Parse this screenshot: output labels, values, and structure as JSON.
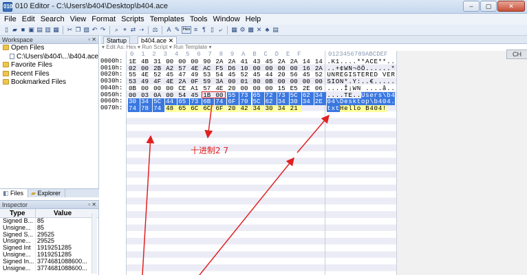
{
  "window": {
    "title": "010 Editor - C:\\Users\\b404\\Desktop\\b404.ace",
    "app_icon": "010",
    "buttons": [
      "–",
      "▢",
      "✕"
    ]
  },
  "menu": [
    "File",
    "Edit",
    "Search",
    "View",
    "Format",
    "Scripts",
    "Templates",
    "Tools",
    "Window",
    "Help"
  ],
  "workspace": {
    "title": "Workspace",
    "items": [
      {
        "label": "Open Files",
        "icon": "folder-icon",
        "indent": 0
      },
      {
        "label": "C:\\Users\\b404\\...\\b404.ace",
        "icon": "file-icon",
        "indent": 1
      },
      {
        "label": "Favorite Files",
        "icon": "folder-icon",
        "indent": 0
      },
      {
        "label": "Recent Files",
        "icon": "folder-icon",
        "indent": 0
      },
      {
        "label": "Bookmarked Files",
        "icon": "folder-icon",
        "indent": 0
      }
    ],
    "tabs": [
      "Files",
      "Explorer"
    ]
  },
  "inspector": {
    "title": "Inspector",
    "col_type": "Type",
    "col_value": "Value",
    "rows": [
      {
        "type": "Signed B...",
        "value": "85"
      },
      {
        "type": "Unsigne...",
        "value": "85"
      },
      {
        "type": "Signed S...",
        "value": "29525"
      },
      {
        "type": "Unsigne...",
        "value": "29525"
      },
      {
        "type": "Signed Int",
        "value": "1919251285"
      },
      {
        "type": "Unsigne...",
        "value": "1919251285"
      },
      {
        "type": "Signed In...",
        "value": "3774681088600..."
      },
      {
        "type": "Unsigne...",
        "value": "3774681088600..."
      }
    ]
  },
  "editor": {
    "tabs": [
      "Startup",
      "b404.ace"
    ],
    "toolbar_text": "▾ Edit As: Hex ▾  Run Script ▾  Run Template ▾",
    "hex_col_header": "0  1  2  3  4  5  6  7  8  9  A  B  C  D  E  F",
    "ascii_col_header": "0123456789ABCDEF",
    "rows": [
      {
        "addr": "0000h:",
        "hex": [
          "1E",
          "4B",
          "31",
          "00",
          "00",
          "00",
          "90",
          "2A",
          "2A",
          "41",
          "43",
          "45",
          "2A",
          "2A",
          "14",
          "14"
        ],
        "ascii": ".K1....**ACE**.."
      },
      {
        "addr": "0010h:",
        "hex": [
          "02",
          "00",
          "2B",
          "A2",
          "57",
          "4E",
          "AC",
          "F5",
          "D6",
          "10",
          "00",
          "00",
          "00",
          "00",
          "16",
          "2A"
        ],
        "ascii": "..+¢WN¬õÖ......*"
      },
      {
        "addr": "0020h:",
        "hex": [
          "55",
          "4E",
          "52",
          "45",
          "47",
          "49",
          "53",
          "54",
          "45",
          "52",
          "45",
          "44",
          "20",
          "56",
          "45",
          "52"
        ],
        "ascii": "UNREGISTERED VER"
      },
      {
        "addr": "0030h:",
        "hex": [
          "53",
          "49",
          "4F",
          "4E",
          "2A",
          "0F",
          "59",
          "3A",
          "00",
          "01",
          "80",
          "0B",
          "00",
          "00",
          "00",
          "00"
        ],
        "ascii": "SION*.Y:..€....."
      },
      {
        "addr": "0040h:",
        "hex": [
          "0B",
          "00",
          "00",
          "00",
          "CE",
          "A1",
          "57",
          "4E",
          "20",
          "00",
          "00",
          "00",
          "15",
          "E5",
          "2E",
          "06"
        ],
        "ascii": "....Î¡WN ....å.."
      },
      {
        "addr": "0050h:",
        "hex": [
          "00",
          "03",
          "0A",
          "00",
          "54",
          "45",
          "1B",
          "00",
          "55",
          "73",
          "65",
          "72",
          "73",
          "5C",
          "62",
          "34"
        ],
        "ascii": "....TE..Users\\b4"
      },
      {
        "addr": "0060h:",
        "hex": [
          "30",
          "34",
          "5C",
          "44",
          "65",
          "73",
          "6B",
          "74",
          "6F",
          "70",
          "5C",
          "62",
          "34",
          "30",
          "34",
          "2E"
        ],
        "ascii": "04\\Desktop\\b404."
      },
      {
        "addr": "0070h:",
        "hex": [
          "74",
          "78",
          "74",
          "48",
          "65",
          "6C",
          "6C",
          "6F",
          "20",
          "42",
          "34",
          "30",
          "34",
          "21"
        ],
        "ascii": "txtHello B404!"
      }
    ],
    "annotation": "十进制2 7",
    "right_badge": "CH"
  },
  "colors": {
    "selection": "#3a78e0",
    "highlight": "#ffff9c",
    "annotation": "#e02020"
  }
}
